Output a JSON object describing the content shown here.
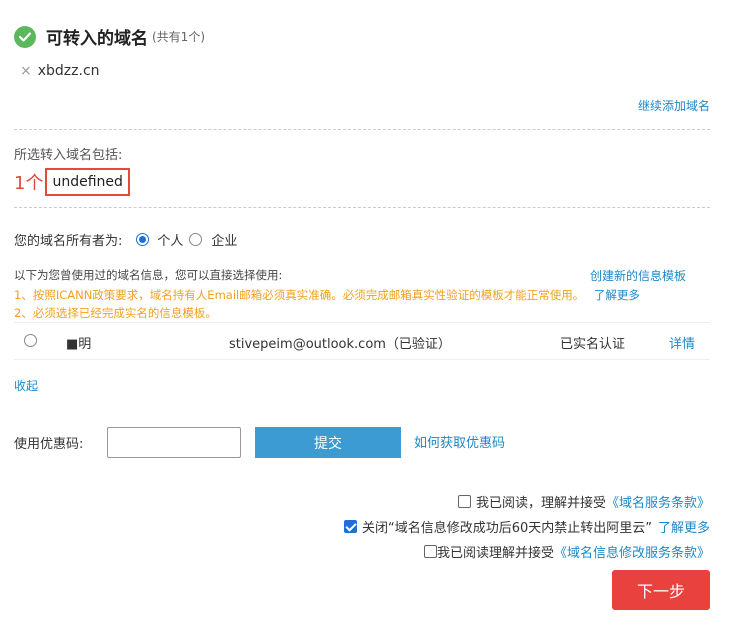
{
  "header": {
    "title": "可转入的域名",
    "count": "(共有1个)"
  },
  "domain_item": {
    "remove_glyph": "×",
    "name": "xbdzz.cn"
  },
  "continue_add_link": "继续添加域名",
  "selected": {
    "label": "所选转入域名包括:",
    "count": "1个",
    "value": "undefined"
  },
  "owner": {
    "label": "您的域名所有者为:",
    "options": [
      {
        "label": "个人",
        "checked": true
      },
      {
        "label": "企业",
        "checked": false
      }
    ]
  },
  "templates": {
    "intro": "以下为您曾使用过的域名信息，您可以直接选择使用:",
    "create_link": "创建新的信息模板",
    "notice_1": "1、按照ICANN政策要求，域名持有人Email邮箱必须真实准确。必须完成邮箱真实性验证的模板才能正常使用。",
    "notice_1_link": "了解更多",
    "notice_2": "2、必须选择已经完成实名的信息模板。",
    "row": {
      "name": "■明",
      "email": "stivepeim@outlook.com（已验证）",
      "status": "已实名认证",
      "detail_link": "详情"
    },
    "collapse_link": "收起"
  },
  "coupon": {
    "label": "使用优惠码:",
    "input_value": "",
    "submit_label": "提交",
    "how_link": "如何获取优惠码"
  },
  "agreements": [
    {
      "text": "我已阅读，理解并接受",
      "link": "《域名服务条款》",
      "checked": false
    },
    {
      "text": "关闭“域名信息修改成功后60天内禁止转出阿里云”",
      "link": "了解更多",
      "checked": true
    },
    {
      "text": "我已阅读理解并接受",
      "link": "《域名信息修改服务条款》",
      "checked": false
    }
  ],
  "next_button": "下一步",
  "colors": {
    "accent_blue": "#1e88c7",
    "submit_blue": "#3d9bd3",
    "next_red": "#e9413d",
    "notice_orange": "#f0a020",
    "success_green": "#5cb85c",
    "highlight_red": "#e04b3b"
  },
  "icons": {
    "header": "check-circle-icon",
    "remove": "close-icon"
  }
}
